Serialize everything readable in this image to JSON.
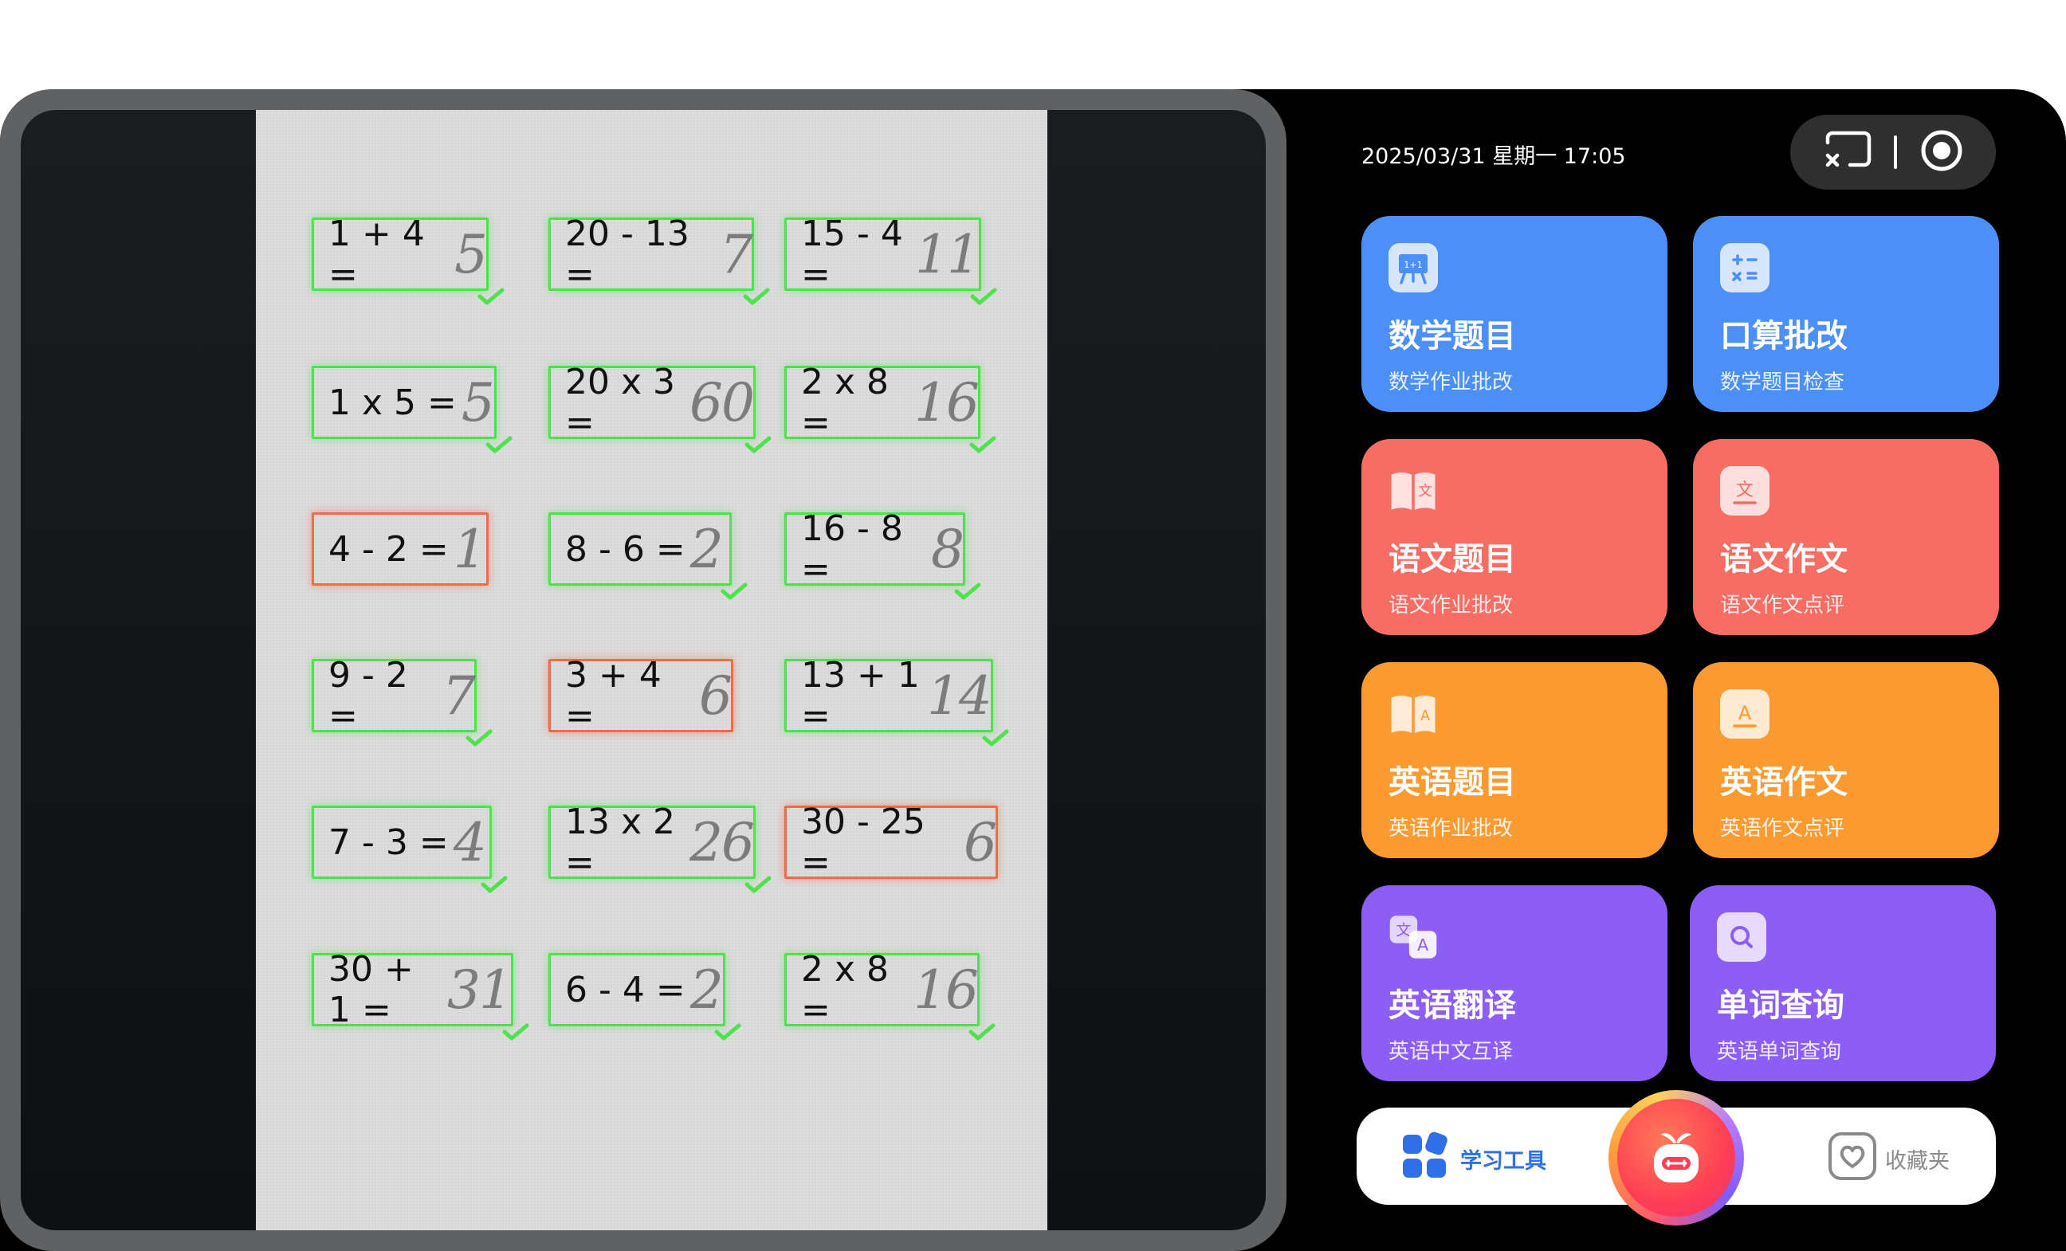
{
  "status": {
    "datetime": "2025/03/31 星期一 17:05"
  },
  "worksheet": {
    "rows": [
      [
        {
          "q": "1 + 4 =",
          "a": "5",
          "ok": true
        },
        {
          "q": "20 - 13 =",
          "a": "7",
          "ok": true
        },
        {
          "q": "15 - 4 =",
          "a": "11",
          "ok": true
        }
      ],
      [
        {
          "q": "1 x 5 =",
          "a": "5",
          "ok": true
        },
        {
          "q": "20 x 3 =",
          "a": "60",
          "ok": true
        },
        {
          "q": "2 x 8 =",
          "a": "16",
          "ok": true
        }
      ],
      [
        {
          "q": "4 - 2 =",
          "a": "1",
          "ok": false
        },
        {
          "q": "8 - 6 =",
          "a": "2",
          "ok": true
        },
        {
          "q": "16 - 8 =",
          "a": "8",
          "ok": true
        }
      ],
      [
        {
          "q": "9 - 2 =",
          "a": "7",
          "ok": true
        },
        {
          "q": "3 + 4 =",
          "a": "6",
          "ok": false
        },
        {
          "q": "13 + 1 =",
          "a": "14",
          "ok": true
        }
      ],
      [
        {
          "q": "7 - 3 =",
          "a": "4",
          "ok": true
        },
        {
          "q": "13 x 2 =",
          "a": "26",
          "ok": true
        },
        {
          "q": "30 - 25 =",
          "a": "6",
          "ok": false
        }
      ],
      [
        {
          "q": "30 + 1 =",
          "a": "31",
          "ok": true
        },
        {
          "q": "6 - 4 =",
          "a": "2",
          "ok": true
        },
        {
          "q": "2 x 8 =",
          "a": "16",
          "ok": true
        }
      ]
    ]
  },
  "cards": [
    {
      "title": "数学题目",
      "sub": "数学作业批改",
      "icon": "blackboard-icon",
      "color": "blue"
    },
    {
      "title": "口算批改",
      "sub": "数学题目检查",
      "icon": "calculator-icon",
      "color": "blue"
    },
    {
      "title": "语文题目",
      "sub": "语文作业批改",
      "icon": "book-icon",
      "color": "red"
    },
    {
      "title": "语文作文",
      "sub": "语文作文点评",
      "icon": "essay-icon",
      "color": "red"
    },
    {
      "title": "英语题目",
      "sub": "英语作业批改",
      "icon": "book-icon",
      "color": "orange"
    },
    {
      "title": "英语作文",
      "sub": "英语作文点评",
      "icon": "essay-icon",
      "color": "orange"
    },
    {
      "title": "英语翻译",
      "sub": "英语中文互译",
      "icon": "translate-icon",
      "color": "purple"
    },
    {
      "title": "单词查询",
      "sub": "英语单词查询",
      "icon": "search-icon",
      "color": "purple"
    }
  ],
  "bottom_nav": {
    "left_label": "学习工具",
    "right_label": "收藏夹"
  },
  "colors": {
    "blue": "#4b8ff7",
    "red": "#f76c63",
    "orange": "#fa9a31",
    "purple": "#8c5ef5",
    "correct": "#4ee24e",
    "wrong": "#f06b4a"
  }
}
